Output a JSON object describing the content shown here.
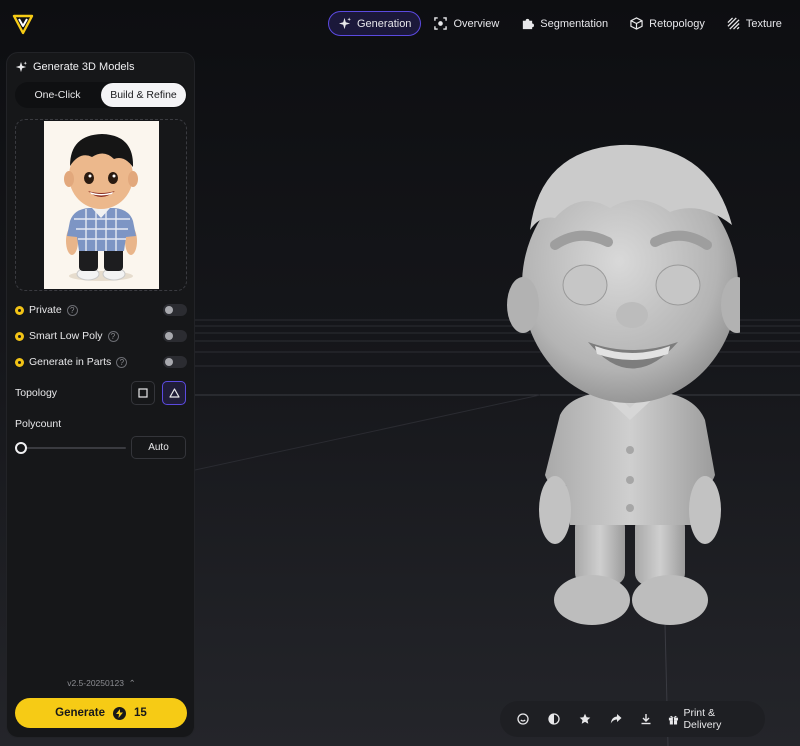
{
  "nav": {
    "items": [
      {
        "label": "Generation",
        "icon": "sparkle-icon",
        "active": true
      },
      {
        "label": "Overview",
        "icon": "scan-icon",
        "active": false
      },
      {
        "label": "Segmentation",
        "icon": "puzzle-icon",
        "active": false
      },
      {
        "label": "Retopology",
        "icon": "cube-icon",
        "active": false
      },
      {
        "label": "Texture",
        "icon": "hatch-icon",
        "active": false
      }
    ]
  },
  "panel": {
    "title": "Generate 3D Models",
    "modes": [
      "One-Click",
      "Build & Refine"
    ],
    "active_mode": "Build & Refine",
    "options": [
      {
        "label": "Private",
        "enabled": false
      },
      {
        "label": "Smart Low Poly",
        "enabled": false
      },
      {
        "label": "Generate in Parts",
        "enabled": false
      }
    ],
    "topology_label": "Topology",
    "polycount_label": "Polycount",
    "polycount_value": "Auto",
    "polycount_fraction": 0,
    "version": "v2.5-20250123",
    "generate_label": "Generate",
    "generate_cost": "15"
  },
  "toolbar": {
    "print_label": "Print & Delivery"
  },
  "colors": {
    "accent": "#5b4ae0",
    "generate": "#f6cb15"
  }
}
